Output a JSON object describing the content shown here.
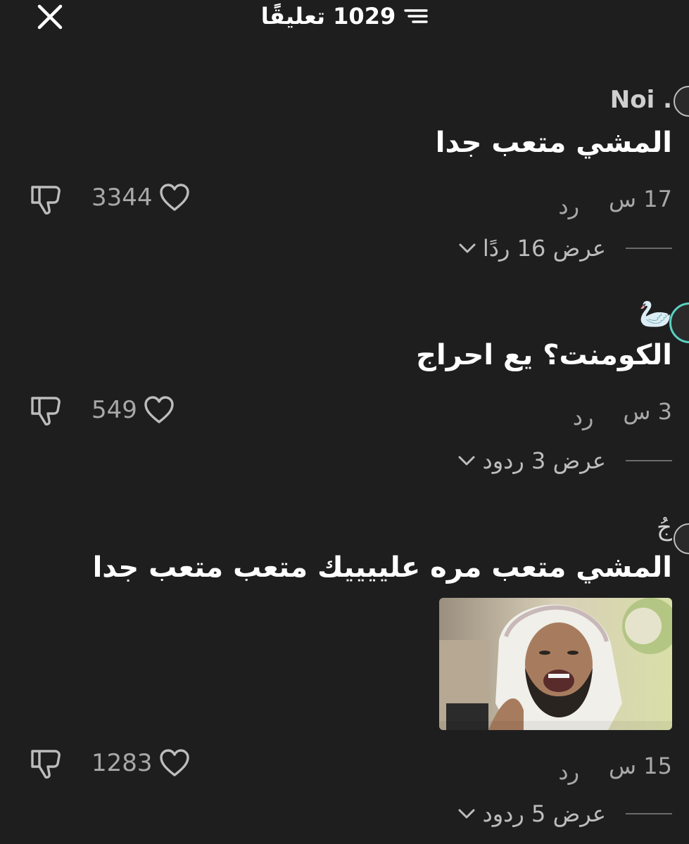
{
  "header": {
    "title": "1029 تعليقًا",
    "close_icon": "close-icon",
    "filter_icon": "filter-icon"
  },
  "comments": [
    {
      "username": "Noi .",
      "text": "المشي متعب جدا",
      "time": "17 س",
      "reply_label": "رد",
      "likes": "3344",
      "view_replies": "عرض 16 ردًا"
    },
    {
      "username": "🦢",
      "text": "الكومنت؟ يع احراج",
      "time": "3 س",
      "reply_label": "رد",
      "likes": "549",
      "view_replies": "عرض 3 ردود"
    },
    {
      "username": "جُ",
      "text": "المشي متعب مره علييييك متعب متعب جدا",
      "time": "15 س",
      "reply_label": "رد",
      "likes": "1283",
      "view_replies": "عرض 5 ردود",
      "media": "image"
    }
  ],
  "colors": {
    "background": "#1e1e1f",
    "secondary_text": "#a8a8a8",
    "accent_ring": "#5ad1c1"
  }
}
